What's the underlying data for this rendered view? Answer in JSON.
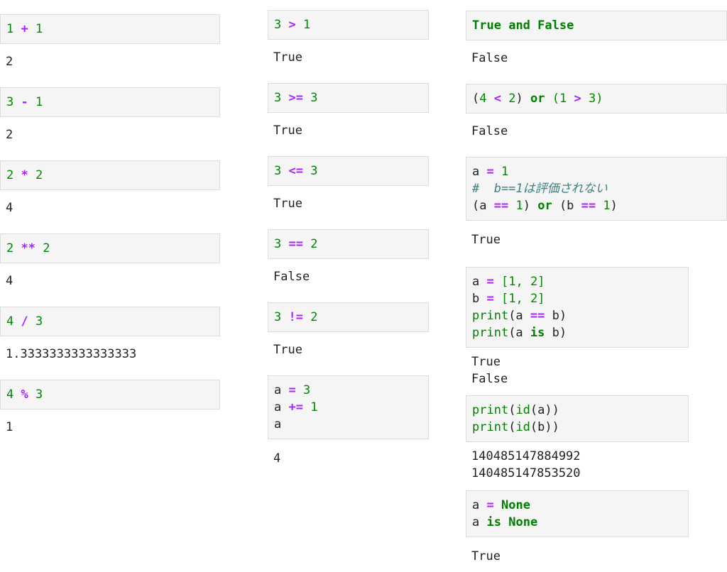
{
  "colors": {
    "number": "#008800",
    "operator": "#aa22ff",
    "keyword": "#008000",
    "builtin": "#008000",
    "comment": "#408080",
    "cell_bg": "#f5f5f5",
    "cell_border": "#dcdcdc"
  },
  "col1": [
    {
      "a": "1",
      "op": "+",
      "b": "1",
      "out": "2"
    },
    {
      "a": "3",
      "op": "-",
      "b": "1",
      "out": "2"
    },
    {
      "a": "2",
      "op": "*",
      "b": "2",
      "out": "4"
    },
    {
      "a": "2",
      "op": "**",
      "b": "2",
      "out": "4"
    },
    {
      "a": "4",
      "op": "/",
      "b": "3",
      "out": "1.3333333333333333"
    },
    {
      "a": "4",
      "op": "%",
      "b": "3",
      "out": "1"
    }
  ],
  "col2": [
    {
      "a": "3",
      "op": ">",
      "b": "1",
      "out": "True"
    },
    {
      "a": "3",
      "op": ">=",
      "b": "3",
      "out": "True"
    },
    {
      "a": "3",
      "op": "<=",
      "b": "3",
      "out": "True"
    },
    {
      "a": "3",
      "op": "==",
      "b": "2",
      "out": "False"
    },
    {
      "a": "3",
      "op": "!=",
      "b": "2",
      "out": "True"
    }
  ],
  "col2_last": {
    "l1_var": "a",
    "l1_op": "=",
    "l1_num": "3",
    "l2_var": "a",
    "l2_op": "+=",
    "l2_num": "1",
    "l3_var": "a",
    "out": "4"
  },
  "col3": {
    "c1": {
      "t1": "True",
      "and": "and",
      "t2": "False",
      "out": "False"
    },
    "c2": {
      "p1": "(",
      "n1": "4",
      "op1": "<",
      "n2": "2",
      "p2": ")",
      "or": "or",
      "p3": "(",
      "n3": "1",
      "op2": ">",
      "n4": "3",
      "p4": ")",
      "out": "False"
    },
    "c3": {
      "l1_var": "a",
      "l1_op": "=",
      "l1_num": "1",
      "comment": "#  b==1は評価されない",
      "l3_p1": "(a ",
      "l3_op1": "==",
      "l3_n1": "1",
      "l3_p2": ")",
      "l3_or": "or",
      "l3_p3": "(b ",
      "l3_op2": "==",
      "l3_n2": "1",
      "l3_p4": ")",
      "out": "True"
    },
    "c4": {
      "l1_var": "a",
      "l1_op": "=",
      "l1_val": "[1, 2]",
      "l2_var": "b",
      "l2_op": "=",
      "l2_val": "[1, 2]",
      "l3_fn": "print",
      "l3_a": "(a ",
      "l3_op": "==",
      "l3_b": " b)",
      "l4_fn": "print",
      "l4_a": "(a ",
      "l4_kw": "is",
      "l4_b": " b)",
      "out1": "True",
      "out2": "False"
    },
    "c5": {
      "l1_fn": "print",
      "l1_p": "(",
      "l1_id": "id",
      "l1_arg": "(a))",
      "l2_fn": "print",
      "l2_p": "(",
      "l2_id": "id",
      "l2_arg": "(b))",
      "out1": "140485147884992",
      "out2": "140485147853520"
    },
    "c6": {
      "l1_var": "a",
      "l1_op": "=",
      "l1_kw": "None",
      "l2_var": "a",
      "l2_kw1": "is",
      "l2_kw2": "None",
      "out": "True"
    }
  }
}
